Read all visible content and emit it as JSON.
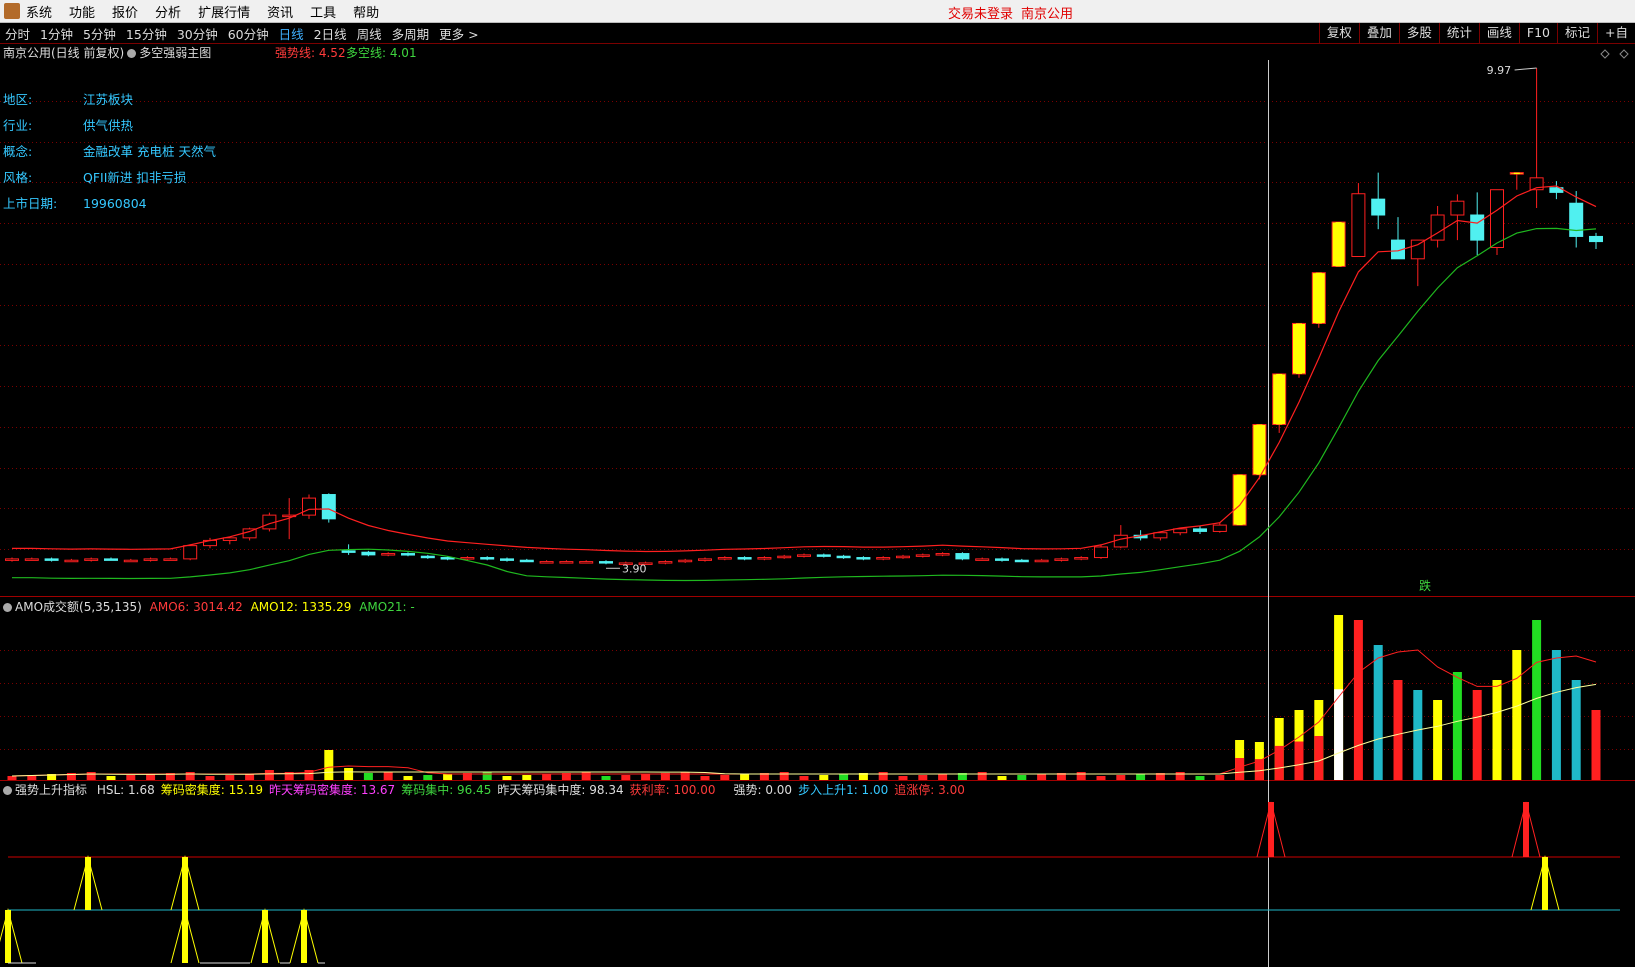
{
  "menu": {
    "items": [
      "系统",
      "功能",
      "报价",
      "分析",
      "扩展行情",
      "资讯",
      "工具",
      "帮助"
    ],
    "status": [
      "交易未登录",
      "南京公用"
    ]
  },
  "periods": [
    "分时",
    "1分钟",
    "5分钟",
    "15分钟",
    "30分钟",
    "60分钟",
    "日线",
    "2日线",
    "周线",
    "多周期",
    "更多 >"
  ],
  "active_period": "日线",
  "tools": [
    "复权",
    "叠加",
    "多股",
    "统计",
    "画线",
    "F10",
    "标记",
    "+自"
  ],
  "main": {
    "title": "南京公用(日线 前复权)",
    "indicator": "多空强弱主图",
    "strong_label": "强势线: 4.52",
    "multi_label": "多空线: 4.01",
    "high_label": "9.97",
    "low_label": "3.90",
    "signal_label": "跌",
    "info": [
      {
        "k": "地区:",
        "v": "江苏板块"
      },
      {
        "k": "行业:",
        "v": "供气供热"
      },
      {
        "k": "概念:",
        "v": "金融改革 充电桩 天然气"
      },
      {
        "k": "风格:",
        "v": "QFII新进 扣非亏损"
      },
      {
        "k": "上市日期:",
        "v": "19960804"
      }
    ]
  },
  "amo": {
    "title": "AMO成交额(5,35,135)",
    "amo6": "AMO6: 3014.42",
    "amo12": "AMO12: 1335.29",
    "amo21": "AMO21: -"
  },
  "trend": {
    "title": "强势上升指标",
    "items": [
      {
        "text": "HSL: 1.68",
        "color": "#dddddd"
      },
      {
        "text": "筹码密集度: 15.19",
        "color": "#ffff00"
      },
      {
        "text": "昨天筹码密集度: 13.67",
        "color": "#ff40ff"
      },
      {
        "text": "筹码集中: 96.45",
        "color": "#3fd63f"
      },
      {
        "text": "昨天筹码集中度: 98.34",
        "color": "#dddddd"
      },
      {
        "text": "获利率: 100.00",
        "color": "#ff3b3b"
      },
      {
        "text": "强势: 0.00",
        "color": "#dddddd"
      },
      {
        "text": "步入上升1: 1.00",
        "color": "#35c8ff"
      },
      {
        "text": "追涨停: 3.00",
        "color": "#ff3b3b"
      }
    ]
  },
  "colors": {
    "up": "#ff2020",
    "down": "#50f0f0",
    "limit": "#ffff00",
    "strong": "#ff2020",
    "multi": "#1fb81f"
  },
  "chart_data": {
    "type": "candlestick",
    "price_range": [
      3.9,
      9.97
    ],
    "candles": [
      [
        3.93,
        3.95,
        3.92,
        3.94
      ],
      [
        3.94,
        3.95,
        3.93,
        3.94
      ],
      [
        3.94,
        3.95,
        3.92,
        3.93
      ],
      [
        3.93,
        3.94,
        3.92,
        3.93
      ],
      [
        3.93,
        3.95,
        3.92,
        3.94
      ],
      [
        3.94,
        3.95,
        3.93,
        3.93
      ],
      [
        3.93,
        3.94,
        3.92,
        3.93
      ],
      [
        3.93,
        3.95,
        3.92,
        3.94
      ],
      [
        3.94,
        3.95,
        3.93,
        3.94
      ],
      [
        3.94,
        4.05,
        3.93,
        4.04
      ],
      [
        4.04,
        4.1,
        4.02,
        4.08
      ],
      [
        4.08,
        4.11,
        4.05,
        4.1
      ],
      [
        4.1,
        4.18,
        4.08,
        4.17
      ],
      [
        4.17,
        4.3,
        4.15,
        4.28
      ],
      [
        4.28,
        4.42,
        4.09,
        4.28
      ],
      [
        4.28,
        4.45,
        4.25,
        4.42
      ],
      [
        4.45,
        4.46,
        4.22,
        4.25
      ],
      [
        4.0,
        4.05,
        3.97,
        3.99
      ],
      [
        3.99,
        4.0,
        3.96,
        3.97
      ],
      [
        3.97,
        3.99,
        3.96,
        3.98
      ],
      [
        3.98,
        3.99,
        3.96,
        3.97
      ],
      [
        3.96,
        3.97,
        3.94,
        3.95
      ],
      [
        3.95,
        3.96,
        3.93,
        3.94
      ],
      [
        3.94,
        3.96,
        3.93,
        3.95
      ],
      [
        3.95,
        3.96,
        3.93,
        3.94
      ],
      [
        3.94,
        3.95,
        3.92,
        3.93
      ],
      [
        3.93,
        3.94,
        3.92,
        3.92
      ],
      [
        3.92,
        3.93,
        3.91,
        3.92
      ],
      [
        3.92,
        3.93,
        3.91,
        3.92
      ],
      [
        3.92,
        3.93,
        3.91,
        3.92
      ],
      [
        3.92,
        3.93,
        3.9,
        3.91
      ],
      [
        3.91,
        3.92,
        3.9,
        3.91
      ],
      [
        3.9,
        3.92,
        3.9,
        3.91
      ],
      [
        3.91,
        3.93,
        3.9,
        3.92
      ],
      [
        3.92,
        3.94,
        3.91,
        3.93
      ],
      [
        3.93,
        3.95,
        3.92,
        3.94
      ],
      [
        3.94,
        3.96,
        3.93,
        3.95
      ],
      [
        3.95,
        3.96,
        3.93,
        3.94
      ],
      [
        3.94,
        3.96,
        3.93,
        3.95
      ],
      [
        3.95,
        3.97,
        3.94,
        3.96
      ],
      [
        3.96,
        3.98,
        3.95,
        3.97
      ],
      [
        3.97,
        3.98,
        3.95,
        3.96
      ],
      [
        3.96,
        3.97,
        3.94,
        3.95
      ],
      [
        3.95,
        3.96,
        3.93,
        3.94
      ],
      [
        3.94,
        3.96,
        3.93,
        3.95
      ],
      [
        3.95,
        3.97,
        3.94,
        3.96
      ],
      [
        3.96,
        3.98,
        3.95,
        3.97
      ],
      [
        3.97,
        3.99,
        3.96,
        3.98
      ],
      [
        3.98,
        3.99,
        3.93,
        3.94
      ],
      [
        3.94,
        3.95,
        3.93,
        3.94
      ],
      [
        3.94,
        3.95,
        3.92,
        3.93
      ],
      [
        3.93,
        3.94,
        3.92,
        3.92
      ],
      [
        3.92,
        3.94,
        3.92,
        3.93
      ],
      [
        3.93,
        3.95,
        3.92,
        3.94
      ],
      [
        3.94,
        3.96,
        3.93,
        3.95
      ],
      [
        3.95,
        4.05,
        3.94,
        4.03
      ],
      [
        4.03,
        4.2,
        4.02,
        4.12
      ],
      [
        4.12,
        4.16,
        4.08,
        4.1
      ],
      [
        4.1,
        4.15,
        4.08,
        4.14
      ],
      [
        4.14,
        4.18,
        4.12,
        4.17
      ],
      [
        4.17,
        4.19,
        4.13,
        4.15
      ],
      [
        4.15,
        4.22,
        4.14,
        4.2
      ],
      [
        4.2,
        4.62,
        4.2,
        4.62
      ],
      [
        4.62,
        5.08,
        4.58,
        5.08
      ],
      [
        5.08,
        5.59,
        5.0,
        5.59
      ],
      [
        5.59,
        6.15,
        5.55,
        6.15
      ],
      [
        6.15,
        6.77,
        6.1,
        6.77
      ],
      [
        6.85,
        7.45,
        6.85,
        7.45
      ],
      [
        6.98,
        8.02,
        6.98,
        7.86
      ],
      [
        7.78,
        8.18,
        7.35,
        7.55
      ],
      [
        7.2,
        7.52,
        7.05,
        6.95
      ],
      [
        6.95,
        7.2,
        6.6,
        7.2
      ],
      [
        7.2,
        7.68,
        7.1,
        7.55
      ],
      [
        7.55,
        7.85,
        7.2,
        7.75
      ],
      [
        7.55,
        7.88,
        7.0,
        7.2
      ],
      [
        7.1,
        7.92,
        7.0,
        7.92
      ],
      [
        8.18,
        8.18,
        7.92,
        8.18
      ],
      [
        7.92,
        9.97,
        7.65,
        8.1
      ],
      [
        7.95,
        8.05,
        7.78,
        7.88
      ],
      [
        7.72,
        7.9,
        7.1,
        7.25
      ],
      [
        7.25,
        7.3,
        7.08,
        7.18
      ]
    ]
  }
}
